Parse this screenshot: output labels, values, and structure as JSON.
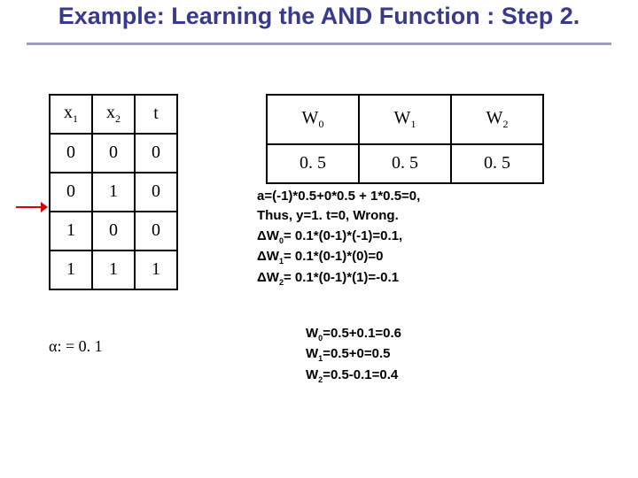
{
  "title": "Example: Learning the AND Function : Step 2.",
  "truth_table": {
    "headers": {
      "c0": "x",
      "s0": "1",
      "c1": "x",
      "s1": "2",
      "c2": "t"
    },
    "rows": [
      {
        "c0": "0",
        "c1": "0",
        "c2": "0"
      },
      {
        "c0": "0",
        "c1": "1",
        "c2": "0"
      },
      {
        "c0": "1",
        "c1": "0",
        "c2": "0"
      },
      {
        "c0": "1",
        "c1": "1",
        "c2": "1"
      }
    ]
  },
  "alpha": {
    "symbol": "α",
    "tail": ": = 0. 1"
  },
  "weight_table": {
    "headers": {
      "h0": "W",
      "s0": "0",
      "h1": "W",
      "s1": "1",
      "h2": "W",
      "s2": "2"
    },
    "values": {
      "v0": "0. 5",
      "v1": "0. 5",
      "v2": "0. 5"
    }
  },
  "calc": {
    "l0": "a=(-1)*0.5+0*0.5 + 1*0.5=0,",
    "l1": "Thus, y=1.  t=0, Wrong.",
    "l2_pre": "W",
    "l2_sub": "0",
    "l2_post": "= 0.1*(0-1)*(-1)=0.1,",
    "l3_pre": "W",
    "l3_sub": "1",
    "l3_post": "= 0.1*(0-1)*(0)=0",
    "l4_pre": "W",
    "l4_sub": "2",
    "l4_post": "= 0.1*(0-1)*(1)=-0.1"
  },
  "updates": {
    "u0_pre": "W",
    "u0_sub": "0",
    "u0_post": "=0.5+0.1=0.6",
    "u1_pre": "W",
    "u1_sub": "1",
    "u1_post": "=0.5+0=0.5",
    "u2_pre": "W",
    "u2_sub": "2",
    "u2_post": "=0.5-0.1=0.4"
  }
}
